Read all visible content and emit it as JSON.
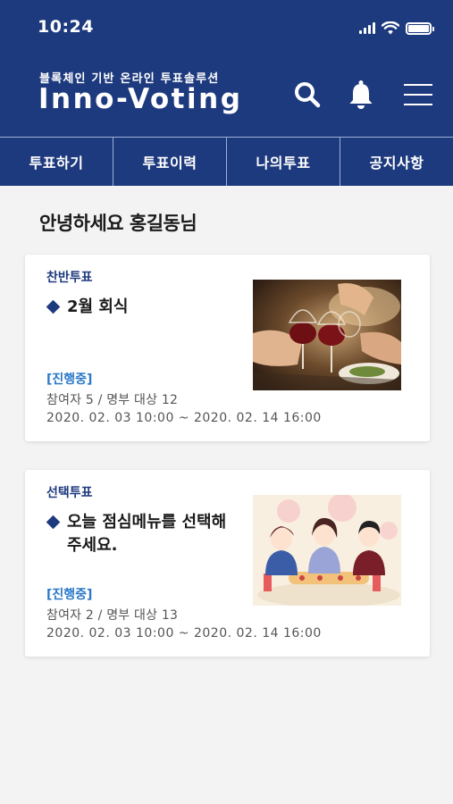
{
  "status_bar": {
    "time": "10:24"
  },
  "header": {
    "subtitle": "블록체인 기반 온라인 투표솔루션",
    "title": "Inno-Voting"
  },
  "tabs": [
    {
      "label": "투표하기"
    },
    {
      "label": "투표이력"
    },
    {
      "label": "나의투표"
    },
    {
      "label": "공지사항"
    }
  ],
  "greeting": "안녕하세요 홍길동님",
  "votes": [
    {
      "type": "찬반투표",
      "title": "2월 회식",
      "status": "[진행중]",
      "participants": "참여자 5 / 명부 대상 12",
      "period": "2020. 02. 03 10:00 ~ 2020. 02. 14 16:00"
    },
    {
      "type": "선택투표",
      "title_line1": "오늘 점심메뉴를 선택해",
      "title_line2": "주세요.",
      "status": "[진행중]",
      "participants": "참여자 2 / 명부 대상 13",
      "period": "2020. 02. 03 10:00 ~ 2020. 02. 14 16:00"
    }
  ],
  "colors": {
    "brand": "#1e3a7e",
    "status": "#2a78c8",
    "background": "#f3f3f4"
  }
}
